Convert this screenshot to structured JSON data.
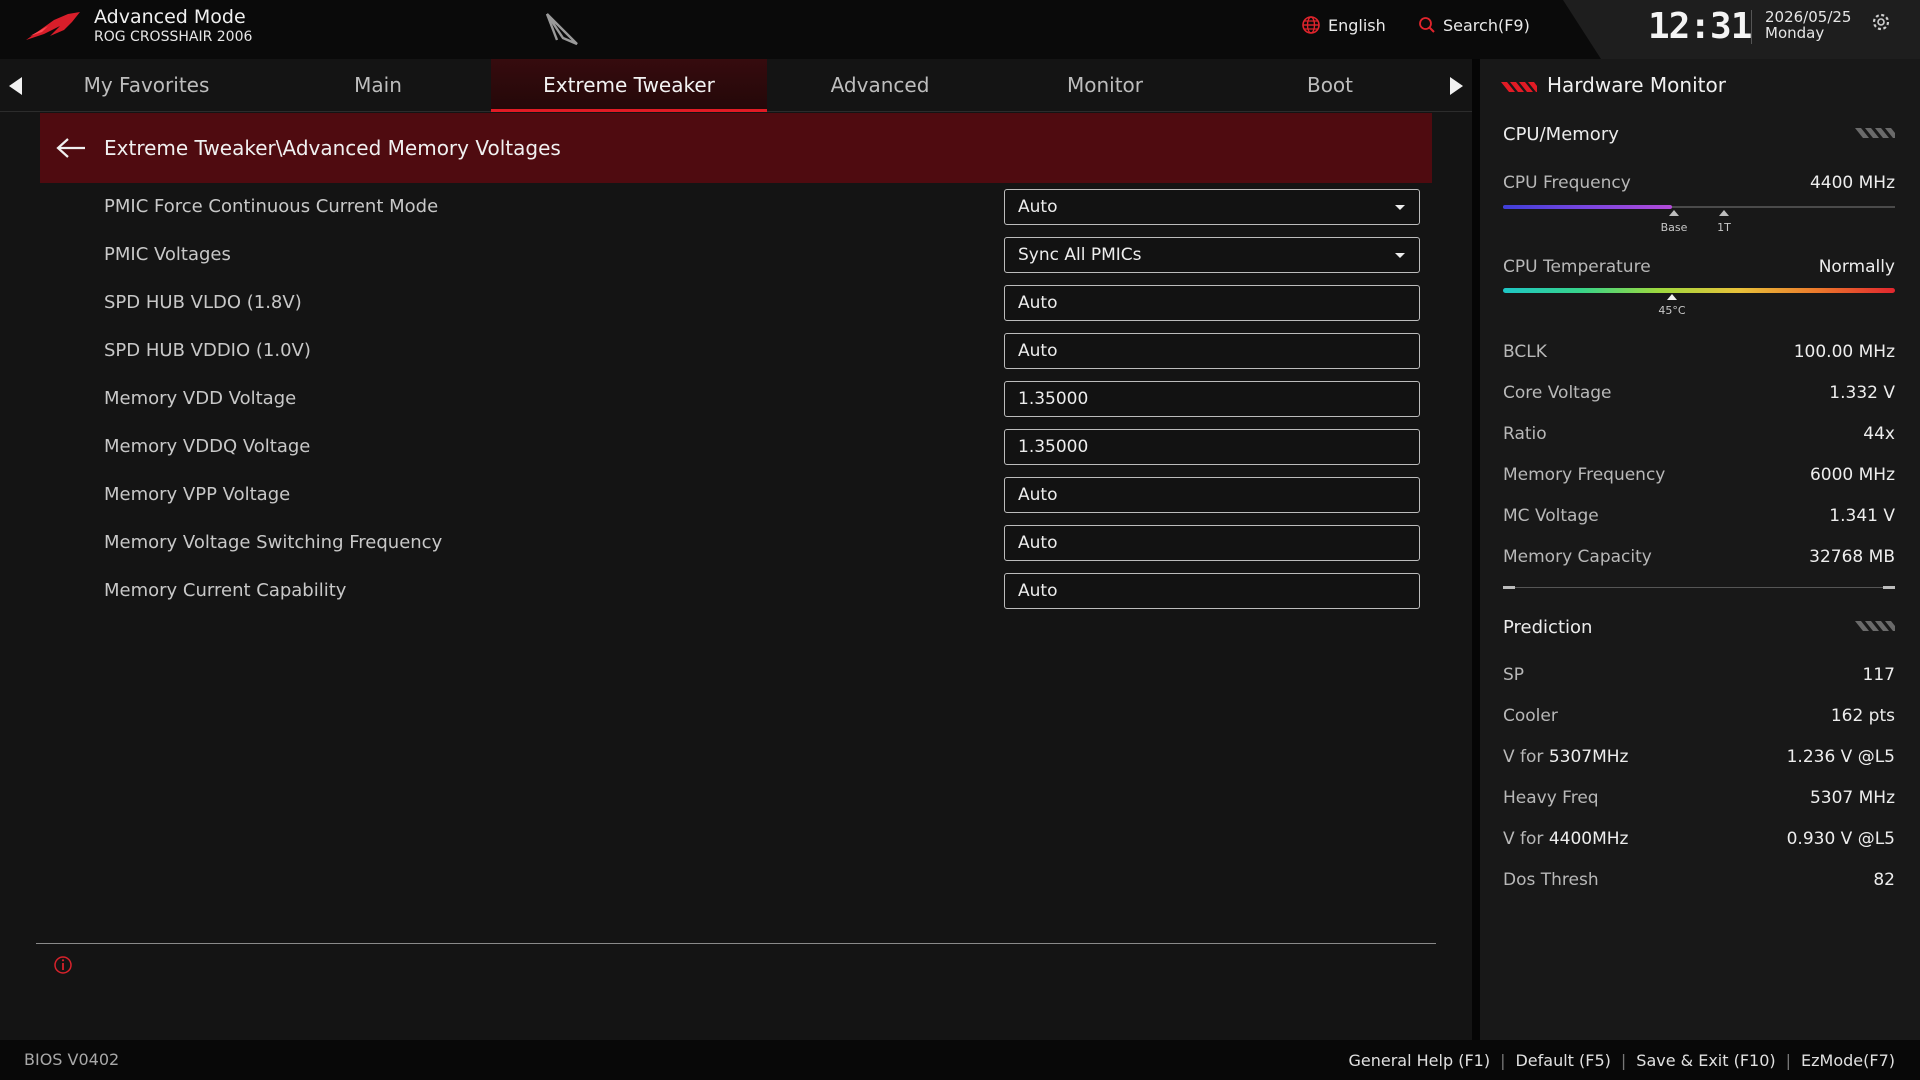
{
  "header": {
    "mode": "Advanced Mode",
    "board": "ROG CROSSHAIR 2006",
    "language": "English",
    "search": "Search(F9)",
    "time": "12:31",
    "date": "2026/05/25",
    "day": "Monday"
  },
  "tabs": [
    {
      "label": "My Favorites",
      "active": false
    },
    {
      "label": "Main",
      "active": false
    },
    {
      "label": "Extreme Tweaker",
      "active": true
    },
    {
      "label": "Advanced",
      "active": false
    },
    {
      "label": "Monitor",
      "active": false
    },
    {
      "label": "Boot",
      "active": false
    }
  ],
  "breadcrumb": "Extreme Tweaker\\Advanced Memory Voltages",
  "settings": [
    {
      "label": "PMIC Force Continuous Current Mode",
      "value": "Auto",
      "dropdown": true
    },
    {
      "label": "PMIC Voltages",
      "value": "Sync All PMICs",
      "dropdown": true
    },
    {
      "label": "SPD HUB VLDO (1.8V)",
      "value": "Auto",
      "dropdown": false
    },
    {
      "label": "SPD HUB VDDIO (1.0V)",
      "value": "Auto",
      "dropdown": false
    },
    {
      "label": "Memory VDD Voltage",
      "value": "1.35000",
      "dropdown": false
    },
    {
      "label": "Memory VDDQ Voltage",
      "value": "1.35000",
      "dropdown": false
    },
    {
      "label": "Memory VPP Voltage",
      "value": "Auto",
      "dropdown": false
    },
    {
      "label": "Memory Voltage Switching Frequency",
      "value": "Auto",
      "dropdown": false
    },
    {
      "label": "Memory Current Capability",
      "value": "Auto",
      "dropdown": false
    }
  ],
  "hw_monitor": {
    "title": "Hardware Monitor",
    "cpu_memory": {
      "title": "CPU/Memory",
      "cpu_frequency": {
        "label": "CPU Frequency",
        "value": "4400 MHz",
        "fill_fraction": 0.43,
        "base_label": "Base",
        "one_t_label": "1T"
      },
      "cpu_temperature": {
        "label": "CPU Temperature",
        "value": "Normally",
        "marker_label": "45°C",
        "marker_fraction": 0.43
      },
      "rows": [
        {
          "label": "BCLK",
          "value": "100.00 MHz"
        },
        {
          "label": "Core Voltage",
          "value": "1.332 V"
        },
        {
          "label": "Ratio",
          "value": "44x"
        },
        {
          "label": "Memory Frequency",
          "value": "6000 MHz"
        },
        {
          "label": "MC Voltage",
          "value": "1.341 V"
        },
        {
          "label": "Memory Capacity",
          "value": "32768 MB"
        }
      ]
    },
    "prediction": {
      "title": "Prediction",
      "sp": {
        "label": "SP",
        "value": "117"
      },
      "cooler": {
        "label": "Cooler",
        "value": "162 pts"
      },
      "v_for_1": {
        "prefix": "V for ",
        "freq": "5307MHz",
        "value": "1.236 V @L5"
      },
      "heavy_freq": {
        "label": "Heavy Freq",
        "value": "5307 MHz"
      },
      "v_for_2": {
        "prefix": "V for ",
        "freq": "4400MHz",
        "value": "0.930 V @L5"
      },
      "dos_thresh": {
        "label": "Dos Thresh",
        "value": "82"
      }
    }
  },
  "footer": {
    "bios_version": "BIOS V0402",
    "general_help": "General Help (F1)",
    "default": "Default (F5)",
    "save_exit": "Save & Exit (F10)",
    "ezmode": "EzMode(F7)"
  },
  "colors": {
    "accent": "#e11b25",
    "breadcrumb_bg": "#4f0b10",
    "background": "#141414"
  }
}
